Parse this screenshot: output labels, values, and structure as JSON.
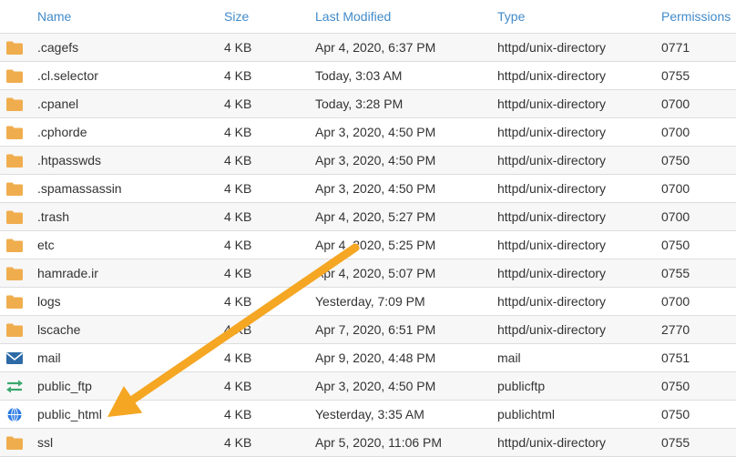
{
  "table": {
    "headers": {
      "name": "Name",
      "size": "Size",
      "modified": "Last Modified",
      "type": "Type",
      "permissions": "Permissions"
    },
    "rows": [
      {
        "icon": "folder-icon",
        "name": ".cagefs",
        "size": "4 KB",
        "modified": "Apr 4, 2020, 6:37 PM",
        "type": "httpd/unix-directory",
        "perm": "0771"
      },
      {
        "icon": "folder-icon",
        "name": ".cl.selector",
        "size": "4 KB",
        "modified": "Today, 3:03 AM",
        "type": "httpd/unix-directory",
        "perm": "0755"
      },
      {
        "icon": "folder-icon",
        "name": ".cpanel",
        "size": "4 KB",
        "modified": "Today, 3:28 PM",
        "type": "httpd/unix-directory",
        "perm": "0700"
      },
      {
        "icon": "folder-icon",
        "name": ".cphorde",
        "size": "4 KB",
        "modified": "Apr 3, 2020, 4:50 PM",
        "type": "httpd/unix-directory",
        "perm": "0700"
      },
      {
        "icon": "folder-icon",
        "name": ".htpasswds",
        "size": "4 KB",
        "modified": "Apr 3, 2020, 4:50 PM",
        "type": "httpd/unix-directory",
        "perm": "0750"
      },
      {
        "icon": "folder-icon",
        "name": ".spamassassin",
        "size": "4 KB",
        "modified": "Apr 3, 2020, 4:50 PM",
        "type": "httpd/unix-directory",
        "perm": "0700"
      },
      {
        "icon": "folder-icon",
        "name": ".trash",
        "size": "4 KB",
        "modified": "Apr 4, 2020, 5:27 PM",
        "type": "httpd/unix-directory",
        "perm": "0700"
      },
      {
        "icon": "folder-icon",
        "name": "etc",
        "size": "4 KB",
        "modified": "Apr 4, 2020, 5:25 PM",
        "type": "httpd/unix-directory",
        "perm": "0750"
      },
      {
        "icon": "folder-icon",
        "name": "hamrade.ir",
        "size": "4 KB",
        "modified": "Apr 4, 2020, 5:07 PM",
        "type": "httpd/unix-directory",
        "perm": "0755"
      },
      {
        "icon": "folder-icon",
        "name": "logs",
        "size": "4 KB",
        "modified": "Yesterday, 7:09 PM",
        "type": "httpd/unix-directory",
        "perm": "0700"
      },
      {
        "icon": "folder-icon",
        "name": "lscache",
        "size": "4 KB",
        "modified": "Apr 7, 2020, 6:51 PM",
        "type": "httpd/unix-directory",
        "perm": "2770"
      },
      {
        "icon": "envelope-icon",
        "name": "mail",
        "size": "4 KB",
        "modified": "Apr 9, 2020, 4:48 PM",
        "type": "mail",
        "perm": "0751"
      },
      {
        "icon": "transfer-arrows-icon",
        "name": "public_ftp",
        "size": "4 KB",
        "modified": "Apr 3, 2020, 4:50 PM",
        "type": "publicftp",
        "perm": "0750"
      },
      {
        "icon": "globe-icon",
        "name": "public_html",
        "size": "4 KB",
        "modified": "Yesterday, 3:35 AM",
        "type": "publichtml",
        "perm": "0750"
      },
      {
        "icon": "folder-icon",
        "name": "ssl",
        "size": "4 KB",
        "modified": "Apr 5, 2020, 11:06 PM",
        "type": "httpd/unix-directory",
        "perm": "0755"
      }
    ]
  },
  "colors": {
    "header_link": "#428bca",
    "folder": "#f0ad4e",
    "envelope": "#2d6aa6",
    "transfer": "#3aa76d",
    "globe": "#2a7ae2",
    "annotation_arrow": "#f5a623"
  }
}
